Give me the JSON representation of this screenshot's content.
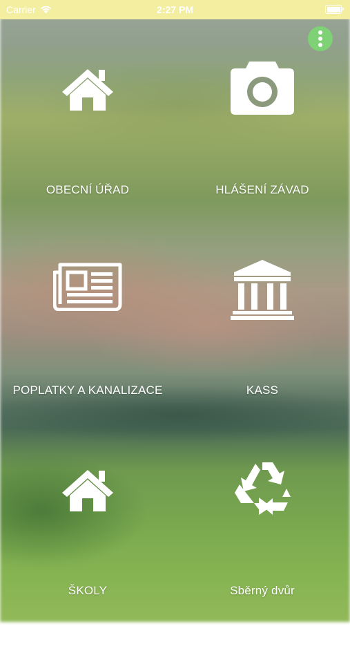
{
  "status_bar": {
    "carrier": "Carrier",
    "time": "2:27 PM"
  },
  "menu": {
    "icon": "more-vertical-icon",
    "color": "#7fd175"
  },
  "tiles": [
    {
      "icon": "home-icon",
      "label": "OBECNÍ ÚŘAD"
    },
    {
      "icon": "camera-icon",
      "label": "HLÁŠENÍ ZÁVAD"
    },
    {
      "icon": "newspaper-icon",
      "label": "POPLATKY A KANALIZACE"
    },
    {
      "icon": "bank-icon",
      "label": "KASS"
    },
    {
      "icon": "home-icon",
      "label": "ŠKOLY"
    },
    {
      "icon": "recycle-icon",
      "label": "Sběrný dvůr"
    }
  ],
  "colors": {
    "status_bar_bg": "#f4eea1",
    "text": "#ffffff"
  }
}
